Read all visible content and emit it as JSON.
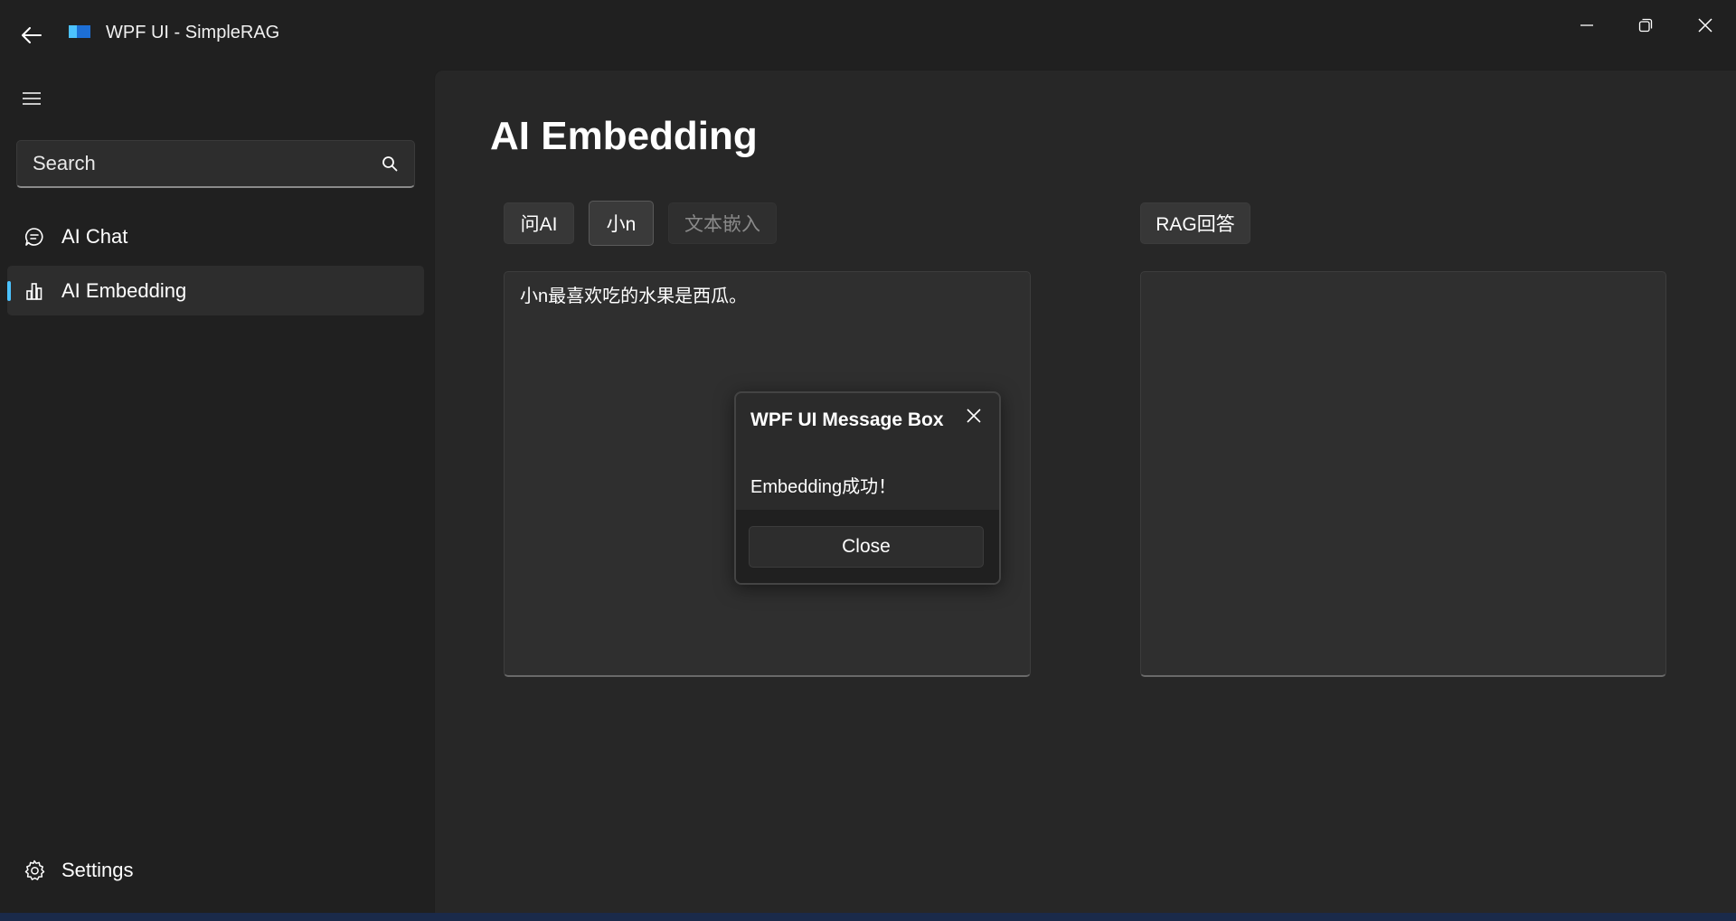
{
  "window": {
    "title": "WPF UI - SimpleRAG"
  },
  "sidebar": {
    "search": {
      "placeholder": "Search",
      "value": ""
    },
    "items": [
      {
        "label": "AI Chat",
        "icon": "chat-icon",
        "active": false
      },
      {
        "label": "AI Embedding",
        "icon": "chart-icon",
        "active": true
      }
    ],
    "footer_item": {
      "label": "Settings",
      "icon": "gear-icon"
    }
  },
  "main": {
    "title": "AI Embedding",
    "buttons": {
      "ask_ai": "问AI",
      "xiao_n": "小n",
      "text_embed": "文本嵌入",
      "rag_answer": "RAG回答"
    },
    "input_text": "小n最喜欢吃的水果是西瓜。",
    "output_text": ""
  },
  "dialog": {
    "title": "WPF UI Message Box",
    "message": "Embedding成功！",
    "close_label": "Close"
  },
  "colors": {
    "accent": "#4cc2ff",
    "background": "#202020",
    "panel": "#272727"
  }
}
